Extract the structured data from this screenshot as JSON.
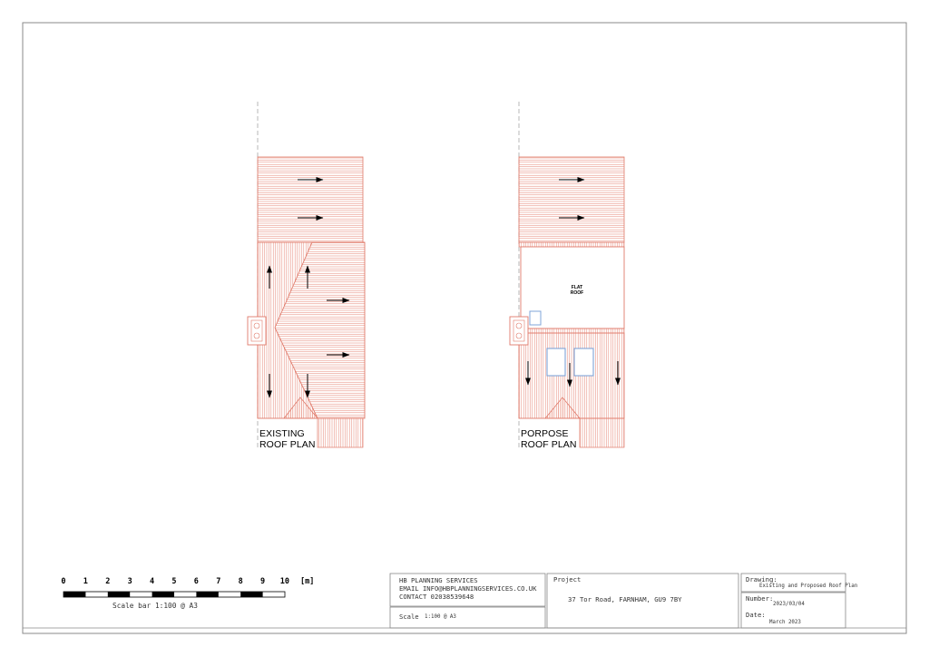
{
  "plans": {
    "existing": {
      "line1": "EXISTING",
      "line2": "ROOF PLAN"
    },
    "proposed": {
      "line1": "PORPOSE",
      "line2": "ROOF PLAN",
      "flat_roof_line1": "FLAT",
      "flat_roof_line2": "ROOF"
    }
  },
  "scale_bar": {
    "ticks": [
      "0",
      "1",
      "2",
      "3",
      "4",
      "5",
      "6",
      "7",
      "8",
      "9",
      "10"
    ],
    "unit": "[m]",
    "caption": "Scale bar 1:100 @ A3"
  },
  "title_block": {
    "company": "HB PLANNING SERVICES",
    "email": "EMAIL INFO@HBPLANNINGSERVICES.CO.UK",
    "contact": "CONTACT 02038539648",
    "scale_label": "Scale",
    "scale_value": "1:100 @ A3",
    "project_label": "Project",
    "project_value": "37 Tor Road, FARNHAM, GU9 7BY",
    "drawing_label": "Drawing:",
    "drawing_value": "Existing and Proposed Roof Plan",
    "number_label": "Number:",
    "number_value": "2023/03/04",
    "date_label": "Date:",
    "date_value": "March 2023"
  },
  "colors": {
    "roof_line": "#e07a6a",
    "frame": "#666666",
    "skylight": "#7fa4d8"
  }
}
